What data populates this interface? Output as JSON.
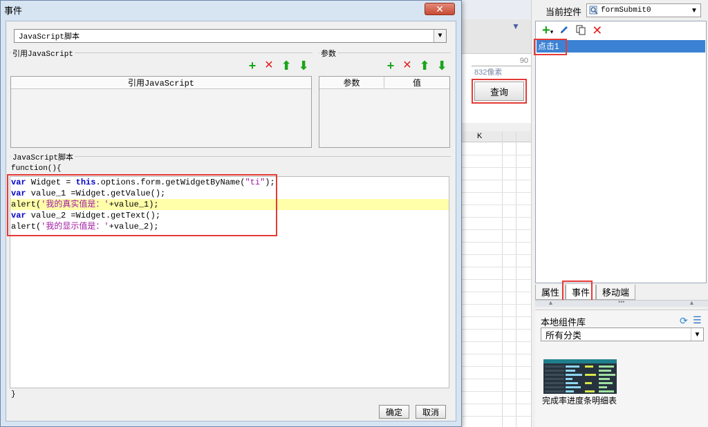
{
  "dialog": {
    "title": "事件",
    "script_type": "JavaScript脚本",
    "ref_js_legend": "引用JavaScript",
    "params_legend": "参数",
    "ref_js_column": "引用JavaScript",
    "param_columns": [
      "参数",
      "值"
    ],
    "script_legend": "JavaScript脚本",
    "code_prefix": "function(){",
    "code_suffix": "}",
    "code_lines": [
      "var Widget = this.options.form.getWidgetByName(\"ti\");",
      "var value_1 =Widget.getValue();",
      "alert('我的真实值是：'+value_1);",
      "var value_2 =Widget.getText();",
      "alert('我的显示值是：'+value_2);"
    ],
    "ok_label": "确定",
    "cancel_label": "取消"
  },
  "designer": {
    "ruler_label": "832像素",
    "ruler_tick": "90",
    "query_button": "查询",
    "grid_column": "K"
  },
  "right_panel": {
    "current_widget_label": "当前控件",
    "current_widget_value": "formSubmit0",
    "event_items": [
      "点击1"
    ],
    "tabs": [
      "属性",
      "事件",
      "移动端"
    ],
    "active_tab": "事件",
    "library_title": "本地组件库",
    "library_category": "所有分类",
    "component_name": "完成率进度条明细表"
  },
  "colors": {
    "accent": "#3c82d4",
    "highlight_box": "#e53935",
    "code_highlight": "#ffffaa"
  }
}
